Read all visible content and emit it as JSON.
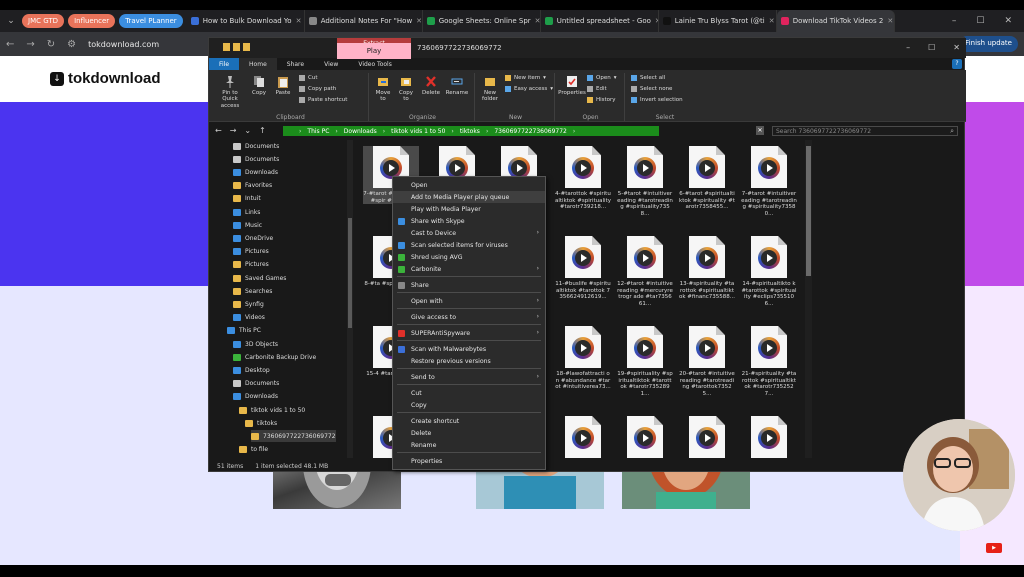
{
  "browser": {
    "tab_groups": [
      {
        "label": "JMC GTD",
        "color": "#e8735a"
      },
      {
        "label": "Influencer",
        "color": "#e8735a"
      },
      {
        "label": "Travel PLanner",
        "color": "#3b8ee0"
      }
    ],
    "tabs": [
      {
        "title": "How to Bulk Download Yo",
        "color": "#3a6fd8"
      },
      {
        "title": "Additional Notes For \"How",
        "color": "#888888"
      },
      {
        "title": "Google Sheets: Online Spr",
        "color": "#1e9e4a"
      },
      {
        "title": "Untitled spreadsheet - Goo",
        "color": "#1e9e4a"
      },
      {
        "title": "Lainie Tru Blyss Tarot (@ti",
        "color": "#111111"
      },
      {
        "title": "Download TikTok Videos 2",
        "color": "#e0245e"
      }
    ],
    "address": "tokdownload.com",
    "finish_update": "Finish update"
  },
  "site": {
    "logo_text": "tokdownload"
  },
  "explorer": {
    "ctx_tab_extract": "Extract",
    "ctx_tab_play": "Play",
    "title": "7360697722736069772",
    "ribbon_tabs": [
      "File",
      "Home",
      "Share",
      "View",
      "Video Tools"
    ],
    "ribbon": {
      "clipboard": {
        "label": "Clipboard",
        "pin": "Pin to Quick access",
        "copy": "Copy",
        "paste": "Paste",
        "cut": "Cut",
        "copy_path": "Copy path",
        "paste_shortcut": "Paste shortcut"
      },
      "organize": {
        "label": "Organize",
        "move_to": "Move to",
        "copy_to": "Copy to",
        "delete": "Delete",
        "rename": "Rename"
      },
      "new": {
        "label": "New",
        "new_folder": "New folder",
        "new_item": "New item",
        "easy_access": "Easy access"
      },
      "open": {
        "label": "Open",
        "properties": "Properties",
        "open": "Open",
        "edit": "Edit",
        "history": "History"
      },
      "select": {
        "label": "Select",
        "select_all": "Select all",
        "select_none": "Select none",
        "invert": "Invert selection"
      }
    },
    "path": [
      "This PC",
      "Downloads",
      "tiktok vids 1 to 50",
      "tiktoks",
      "7360697722736069772"
    ],
    "search_placeholder": "Search 7360697722736069772",
    "nav_items": [
      {
        "label": "Documents",
        "indent": 1,
        "color": "#c9c9c9"
      },
      {
        "label": "Documents",
        "indent": 1,
        "color": "#c9c9c9"
      },
      {
        "label": "Downloads",
        "indent": 1,
        "color": "#3b8ee0"
      },
      {
        "label": "Favorites",
        "indent": 1,
        "color": "#e8b84a"
      },
      {
        "label": "Intuit",
        "indent": 1,
        "color": "#e8b84a"
      },
      {
        "label": "Links",
        "indent": 1,
        "color": "#3b8ee0"
      },
      {
        "label": "Music",
        "indent": 1,
        "color": "#3b8ee0"
      },
      {
        "label": "OneDrive",
        "indent": 1,
        "color": "#3b8ee0"
      },
      {
        "label": "Pictures",
        "indent": 1,
        "color": "#3b8ee0"
      },
      {
        "label": "Pictures",
        "indent": 1,
        "color": "#e8b84a"
      },
      {
        "label": "Saved Games",
        "indent": 1,
        "color": "#e8b84a"
      },
      {
        "label": "Searches",
        "indent": 1,
        "color": "#e8b84a"
      },
      {
        "label": "Synfig",
        "indent": 1,
        "color": "#e8b84a"
      },
      {
        "label": "Videos",
        "indent": 1,
        "color": "#3b8ee0"
      },
      {
        "label": "This PC",
        "indent": 0,
        "color": "#3b8ee0"
      },
      {
        "label": "3D Objects",
        "indent": 1,
        "color": "#3b8ee0"
      },
      {
        "label": "Carbonite Backup Drive",
        "indent": 1,
        "color": "#3bb33b"
      },
      {
        "label": "Desktop",
        "indent": 1,
        "color": "#3b8ee0"
      },
      {
        "label": "Documents",
        "indent": 1,
        "color": "#c9c9c9"
      },
      {
        "label": "Downloads",
        "indent": 1,
        "color": "#3b8ee0"
      },
      {
        "label": "tiktok vids 1 to 50",
        "indent": 2,
        "color": "#e8b84a"
      },
      {
        "label": "tiktoks",
        "indent": 3,
        "color": "#e8b84a"
      },
      {
        "label": "7360697722736069772",
        "indent": 4,
        "color": "#e8b84a",
        "selected": true
      },
      {
        "label": "to file",
        "indent": 2,
        "color": "#e8b84a"
      }
    ],
    "files": [
      {
        "label": "7-#tarot #tarot #sp #spir #tp7360",
        "col": 0,
        "row": 0,
        "selected": true
      },
      {
        "label": "",
        "col": 1,
        "row": 0
      },
      {
        "label": "",
        "col": 2,
        "row": 0
      },
      {
        "label": "4-#tarottok #spiritualtiktok #spirituality #tarotr739218...",
        "col": 3,
        "row": 0
      },
      {
        "label": "5-#tarot #intuitivereading #tarotreading #spirituality7358...",
        "col": 4,
        "row": 0
      },
      {
        "label": "6-#tarot #spiritualtiktok #spirituality #tarotr7358455...",
        "col": 5,
        "row": 0
      },
      {
        "label": "7-#tarot #intuitivereading #tarotreading #spirituality73580...",
        "col": 6,
        "row": 0
      },
      {
        "label": "8-#ta #spiri #tarot",
        "col": 0,
        "row": 1
      },
      {
        "label": "11-#buslife #spiritualtiktok #tarottok 7356624912619...",
        "col": 3,
        "row": 1
      },
      {
        "label": "12-#tarot #intuitivereading #mercuryretrogr ade #tar735661...",
        "col": 4,
        "row": 1
      },
      {
        "label": "13-#spirituality #tarottok #spiritualtiktok #financ735588...",
        "col": 5,
        "row": 1
      },
      {
        "label": "14-#spiritualtikto k #tarottok #spirituality #eclips7355106...",
        "col": 6,
        "row": 1
      },
      {
        "label": "15-4 #taro #tarot",
        "col": 0,
        "row": 2
      },
      {
        "label": "18-#lawofattracti on #abundance #tarot #intuitiverea73...",
        "col": 3,
        "row": 2
      },
      {
        "label": "19-#spirituality #spiritualtiktok #tarottok #tarotr7352891...",
        "col": 4,
        "row": 2
      },
      {
        "label": "20-#tarot #intuitivereading #tarotreading #tarottok73525...",
        "col": 5,
        "row": 2
      },
      {
        "label": "21-#spirituality #tarottok #spiritualtiktok #tarotr7352527...",
        "col": 6,
        "row": 2
      },
      {
        "label": "",
        "col": 0,
        "row": 3
      },
      {
        "label": "",
        "col": 3,
        "row": 3
      },
      {
        "label": "",
        "col": 4,
        "row": 3
      },
      {
        "label": "",
        "col": 5,
        "row": 3
      },
      {
        "label": "",
        "col": 6,
        "row": 3
      }
    ],
    "status": {
      "items": "51 items",
      "selected": "1 item selected  48.1 MB"
    }
  },
  "context_menu": [
    {
      "label": "Open",
      "type": "item"
    },
    {
      "label": "Add to Media Player play queue",
      "type": "item",
      "hover": true
    },
    {
      "label": "Play with Media Player",
      "type": "item"
    },
    {
      "label": "Share with Skype",
      "type": "item",
      "icon": "#3b8ee0"
    },
    {
      "label": "Cast to Device",
      "type": "item",
      "sub": true
    },
    {
      "label": "Scan selected items for viruses",
      "type": "item",
      "icon": "#3b8ee0"
    },
    {
      "label": "Shred using AVG",
      "type": "item",
      "icon": "#3bb33b"
    },
    {
      "label": "Carbonite",
      "type": "item",
      "sub": true,
      "icon": "#3bb33b"
    },
    {
      "type": "sep"
    },
    {
      "label": "Share",
      "type": "item",
      "icon": "#888888"
    },
    {
      "type": "sep"
    },
    {
      "label": "Open with",
      "type": "item",
      "sub": true
    },
    {
      "type": "sep"
    },
    {
      "label": "Give access to",
      "type": "item",
      "sub": true
    },
    {
      "type": "sep"
    },
    {
      "label": "SUPERAntiSpyware",
      "type": "item",
      "sub": true,
      "icon": "#e0302a"
    },
    {
      "type": "sep"
    },
    {
      "label": "Scan with Malwarebytes",
      "type": "item",
      "icon": "#3b6fd8"
    },
    {
      "label": "Restore previous versions",
      "type": "item"
    },
    {
      "type": "sep"
    },
    {
      "label": "Send to",
      "type": "item",
      "sub": true
    },
    {
      "type": "sep"
    },
    {
      "label": "Cut",
      "type": "item"
    },
    {
      "label": "Copy",
      "type": "item"
    },
    {
      "type": "sep"
    },
    {
      "label": "Create shortcut",
      "type": "item"
    },
    {
      "label": "Delete",
      "type": "item"
    },
    {
      "label": "Rename",
      "type": "item"
    },
    {
      "type": "sep"
    },
    {
      "label": "Properties",
      "type": "item"
    }
  ]
}
